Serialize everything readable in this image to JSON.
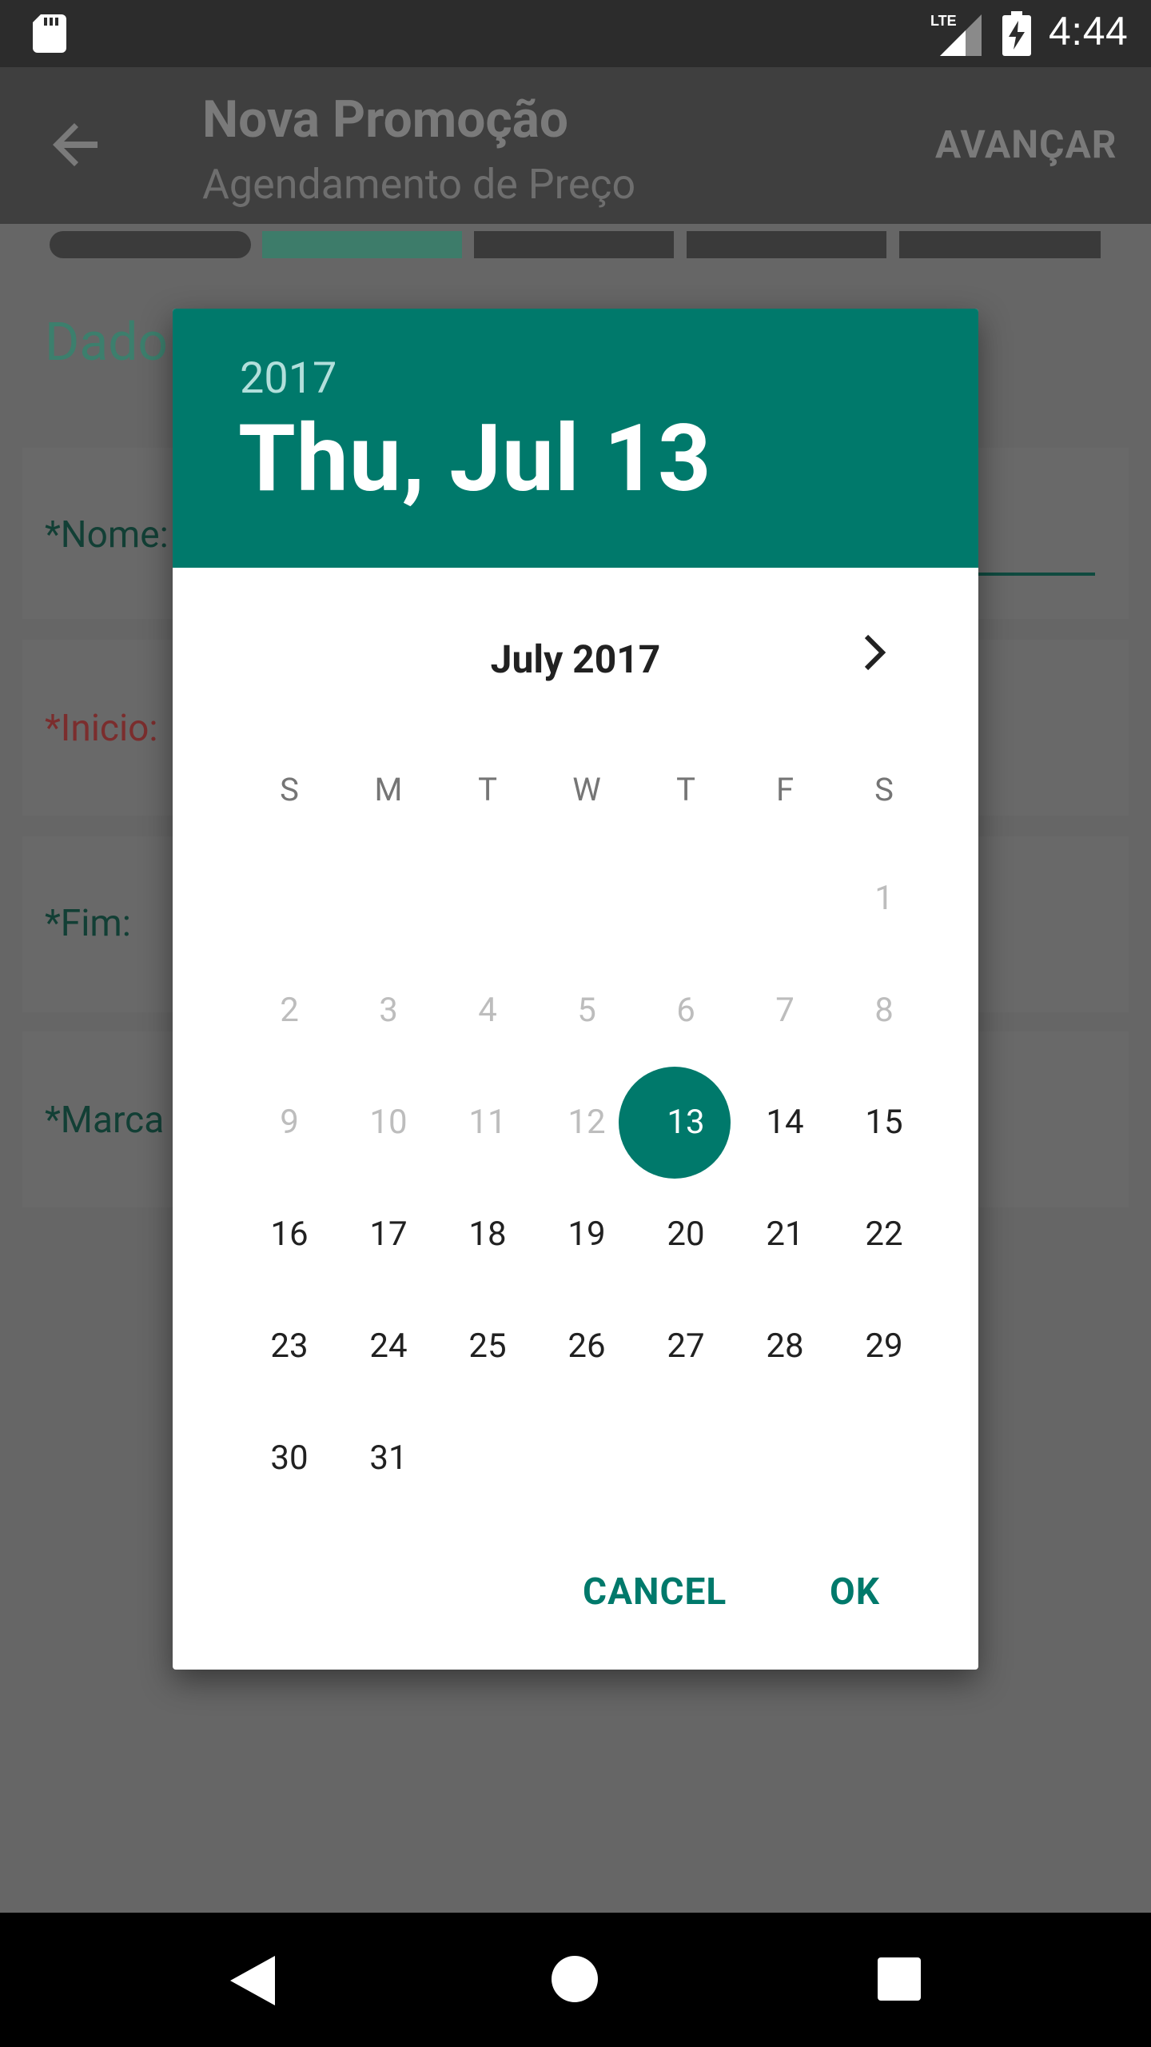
{
  "status_bar": {
    "time": "4:44",
    "network": "LTE",
    "icons": [
      "sd-card-icon",
      "lte-signal-icon",
      "battery-charging-icon"
    ]
  },
  "app_bar": {
    "title": "Nova Promoção",
    "subtitle": "Agendamento de Preço",
    "action_label": "AVANÇAR",
    "back_icon": "arrow-left-icon"
  },
  "stepper": {
    "steps": 5,
    "active_step": 2,
    "active_color": "#3d7c6a"
  },
  "form": {
    "section_title": "Dado",
    "fields": [
      {
        "label": "*Nome:",
        "required_color": "#123f35"
      },
      {
        "label": "*Inicio:",
        "required_color": "#7b2d2d"
      },
      {
        "label": "*Fim:",
        "required_color": "#123f35"
      },
      {
        "label": "*Marca",
        "required_color": "#123f35"
      }
    ]
  },
  "date_picker": {
    "header_year": "2017",
    "header_date": "Thu, Jul 13",
    "month_label": "July 2017",
    "next_icon": "chevron-right-icon",
    "weekdays": [
      "S",
      "M",
      "T",
      "W",
      "T",
      "F",
      "S"
    ],
    "selected_day": "13",
    "accent_color": "#00796b",
    "weeks": [
      [
        null,
        null,
        null,
        null,
        null,
        null,
        {
          "label": "1",
          "disabled": true
        }
      ],
      [
        {
          "label": "2",
          "disabled": true
        },
        {
          "label": "3",
          "disabled": true
        },
        {
          "label": "4",
          "disabled": true
        },
        {
          "label": "5",
          "disabled": true
        },
        {
          "label": "6",
          "disabled": true
        },
        {
          "label": "7",
          "disabled": true
        },
        {
          "label": "8",
          "disabled": true
        }
      ],
      [
        {
          "label": "9",
          "disabled": true
        },
        {
          "label": "10",
          "disabled": true
        },
        {
          "label": "11",
          "disabled": true
        },
        {
          "label": "12",
          "disabled": true
        },
        {
          "label": "13",
          "selected": true
        },
        {
          "label": "14"
        },
        {
          "label": "15"
        }
      ],
      [
        {
          "label": "16"
        },
        {
          "label": "17"
        },
        {
          "label": "18"
        },
        {
          "label": "19"
        },
        {
          "label": "20"
        },
        {
          "label": "21"
        },
        {
          "label": "22"
        }
      ],
      [
        {
          "label": "23"
        },
        {
          "label": "24"
        },
        {
          "label": "25"
        },
        {
          "label": "26"
        },
        {
          "label": "27"
        },
        {
          "label": "28"
        },
        {
          "label": "29"
        }
      ],
      [
        {
          "label": "30"
        },
        {
          "label": "31"
        },
        null,
        null,
        null,
        null,
        null
      ]
    ],
    "cancel_label": "CANCEL",
    "ok_label": "OK"
  },
  "nav_bar": {
    "icons": [
      "nav-back-icon",
      "nav-home-icon",
      "nav-recents-icon"
    ]
  }
}
